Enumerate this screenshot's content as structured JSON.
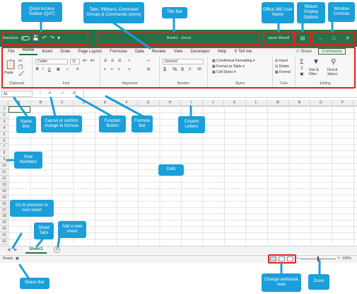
{
  "title_bar": {
    "autosave_label": "AutoSave",
    "autosave_state": "Off",
    "document_title": "Book1 - Excel",
    "user_name": "Jason Morrell",
    "ribbon_display_icon": "ribbon-display-icon",
    "window_controls": [
      "minimize-icon",
      "restore-icon",
      "close-icon"
    ]
  },
  "tabs": [
    "File",
    "Home",
    "Insert",
    "Draw",
    "Page Layout",
    "Formulas",
    "Data",
    "Review",
    "View",
    "Developer",
    "Help"
  ],
  "active_tab": "Home",
  "tell_me": "Tell me",
  "share_label": "Share",
  "comments_label": "Comments",
  "ribbon": {
    "clipboard": {
      "paste": "Paste",
      "label": "Clipboard"
    },
    "font": {
      "name": "Calibri",
      "size": "11",
      "label": "Font"
    },
    "alignment": {
      "label": "Alignment"
    },
    "number": {
      "format": "General",
      "label": "Number"
    },
    "styles": {
      "items": [
        "Conditional Formatting",
        "Format as Table",
        "Cell Styles"
      ],
      "label": "Styles"
    },
    "cells": {
      "items": [
        "Insert",
        "Delete",
        "Format"
      ],
      "label": "Cells"
    },
    "editing": {
      "sort": "Sort & Filter",
      "find": "Find & Select",
      "label": "Editing"
    }
  },
  "formula_bar": {
    "name_box": "A1",
    "fx": "fx"
  },
  "columns": [
    "A",
    "B",
    "C",
    "D",
    "E",
    "F",
    "G",
    "H",
    "I",
    "J",
    "K",
    "L",
    "M",
    "N",
    "O",
    "P"
  ],
  "rows": [
    "1",
    "2",
    "3",
    "4",
    "5",
    "6",
    "7",
    "8",
    "9",
    "10",
    "11",
    "12",
    "13",
    "14",
    "15",
    "16",
    "17",
    "18",
    "19",
    "20",
    "21",
    "22"
  ],
  "sheet_tab": "Sheet1",
  "status": "Ready",
  "zoom": "100%",
  "colors": {
    "excel_green": "#217346",
    "callout_blue": "#1b9fd9",
    "highlight_red": "#e2231a"
  },
  "callouts": {
    "qat": "Quick Access Toolbar (QAT)",
    "tabs": "Tabs, Ribbons, Command Groups & Commands (icons)",
    "title_bar": "Title Bar",
    "user_name": "Office 365 User Name",
    "ribbon_display": "Ribbon Display Options",
    "window_controls": "Window Controls",
    "name_box": "Name Box",
    "cancel_confirm": "Cancel or confirm change to formula",
    "function_button": "Function Button",
    "formula_bar": "Formula Bar",
    "column_letters": "Column Letters",
    "row_numbers": "Row Numbers",
    "cells": "Cells",
    "prev_next": "Go to previous or next sheet",
    "sheet_tabs": "Sheet Tabs",
    "add_sheet": "Add a new sheet",
    "status_bar": "Status Bar",
    "change_view": "Change workbook view",
    "zoom": "Zoom"
  }
}
